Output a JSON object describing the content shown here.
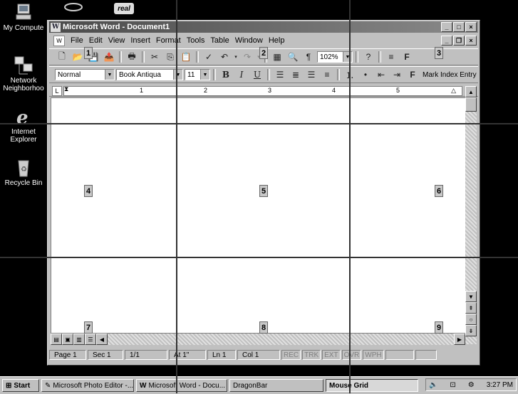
{
  "desktop": {
    "icons": [
      {
        "label": "My Compute",
        "icon": "my-computer-icon"
      },
      {
        "label": "Network Neighborhoo",
        "icon": "network-neighborhood-icon"
      },
      {
        "label": "Internet Explorer",
        "icon": "internet-explorer-icon"
      },
      {
        "label": "Recycle Bin",
        "icon": "recycle-bin-icon"
      }
    ],
    "top_logo": "real"
  },
  "word": {
    "title": "Microsoft Word - Document1",
    "menu": [
      "File",
      "Edit",
      "View",
      "Insert",
      "Format",
      "Tools",
      "Table",
      "Window",
      "Help"
    ],
    "zoom": "102%",
    "style": "Normal",
    "font": "Book Antiqua",
    "font_size": "11",
    "format_buttons": {
      "bold": "B",
      "italic": "I",
      "underline": "U"
    },
    "mark_index": "Mark Index Entry",
    "ruler_numbers": [
      "1",
      "2",
      "3",
      "4",
      "5"
    ],
    "status": {
      "page": "Page 1",
      "sec": "Sec 1",
      "pages": "1/1",
      "at": "At 1\"",
      "ln": "Ln 1",
      "col": "Col 1",
      "rec": "REC",
      "trk": "TRK",
      "ext": "EXT",
      "ovr": "OVR",
      "wph": "WPH"
    }
  },
  "mouse_grid": {
    "numbers": [
      "1",
      "2",
      "3",
      "4",
      "5",
      "6",
      "7",
      "8",
      "9"
    ]
  },
  "taskbar": {
    "start": "Start",
    "buttons": [
      "Microsoft Photo Editor -...",
      "Microsoft Word - Docu...",
      "DragonBar",
      "Mouse Grid"
    ],
    "clock": "3:27 PM"
  }
}
